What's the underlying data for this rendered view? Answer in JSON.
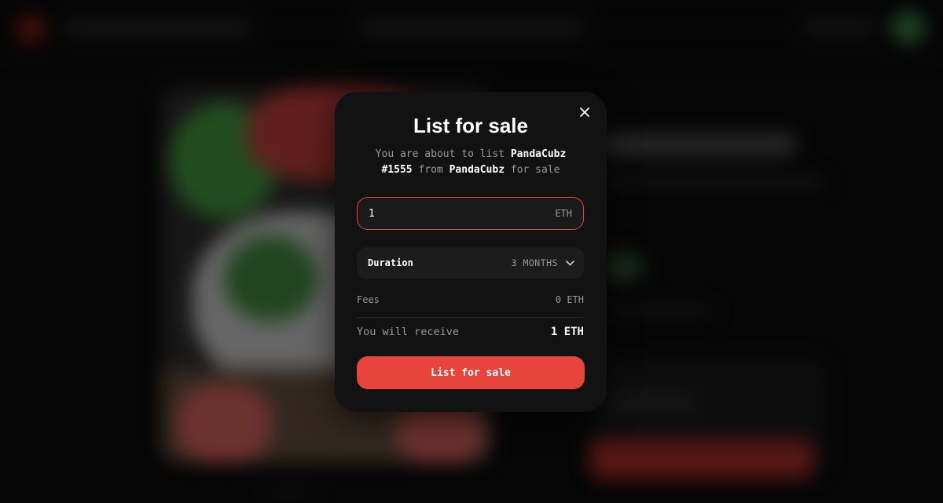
{
  "modal": {
    "title": "List for sale",
    "description": {
      "prefix": "You are about to list ",
      "item_name": "PandaCubz #1555",
      "from_word": " from ",
      "collection": "PandaCubz",
      "suffix": " for sale"
    },
    "price": {
      "value": "1",
      "currency": "ETH"
    },
    "duration": {
      "label": "Duration",
      "value": "3 MONTHS",
      "icon": "chevron-down-icon"
    },
    "fees": {
      "label": "Fees",
      "value": "0 ETH"
    },
    "receive": {
      "label": "You will receive",
      "value": "1 ETH"
    },
    "submit_label": "List for sale",
    "close_icon": "close-icon"
  },
  "colors": {
    "accent": "#e7453b",
    "modal_bg": "#121212",
    "muted_text": "#9a9a9a",
    "page_bg": "#0b0b0b"
  }
}
